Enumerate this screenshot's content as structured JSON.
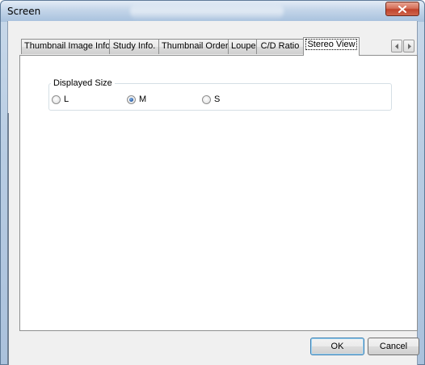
{
  "window": {
    "title": "Screen"
  },
  "tabs": [
    {
      "label": "Thumbnail Image Info."
    },
    {
      "label": "Study Info."
    },
    {
      "label": "Thumbnail Order"
    },
    {
      "label": "Loupe"
    },
    {
      "label": "C/D Ratio"
    },
    {
      "label": "Stereo View",
      "active": true
    }
  ],
  "stereo_view": {
    "group_label": "Displayed Size",
    "options": [
      {
        "label": "L",
        "checked": false
      },
      {
        "label": "M",
        "checked": true
      },
      {
        "label": "S",
        "checked": false
      }
    ]
  },
  "buttons": {
    "ok": "OK",
    "cancel": "Cancel"
  },
  "icons": {
    "close": "close-icon",
    "scroll_left": "chevron-left-icon",
    "scroll_right": "chevron-right-icon"
  }
}
